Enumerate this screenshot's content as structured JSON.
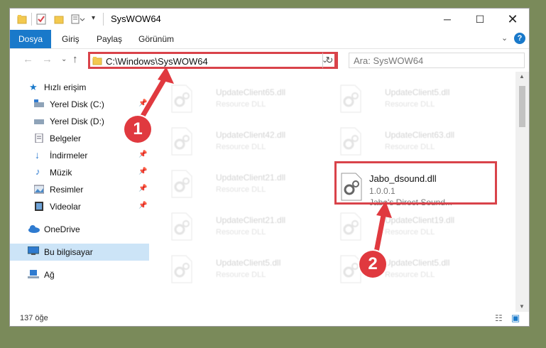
{
  "window": {
    "title": "SysWOW64"
  },
  "ribbon": {
    "tabs": [
      "Dosya",
      "Giriş",
      "Paylaş",
      "Görünüm"
    ]
  },
  "address": {
    "path": "C:\\Windows\\SysWOW64",
    "search_placeholder": "Ara: SysWOW64"
  },
  "sidebar": {
    "items": [
      {
        "label": "Hızlı erişim"
      },
      {
        "label": "Yerel Disk (C:)"
      },
      {
        "label": "Yerel Disk (D:)"
      },
      {
        "label": "Belgeler"
      },
      {
        "label": "İndirmeler"
      },
      {
        "label": "Müzik"
      },
      {
        "label": "Resimler"
      },
      {
        "label": "Videolar"
      },
      {
        "label": "OneDrive"
      },
      {
        "label": "Bu bilgisayar"
      },
      {
        "label": "Ağ"
      }
    ]
  },
  "files": [
    {
      "name": "UpdateClient65.dll",
      "desc": "Resource DLL"
    },
    {
      "name": "UpdateClient5.dll",
      "desc": "Resource DLL"
    },
    {
      "name": "UpdateClient42.dll",
      "desc": "Resource DLL"
    },
    {
      "name": "UpdateClient63.dll",
      "desc": "Resource DLL"
    },
    {
      "name": "UpdateClient21.dll",
      "desc": "Resource DLL"
    },
    {
      "name": "Jabo_dsound.dll",
      "version": "1.0.0.1",
      "desc": "Jabo's Direct Sound..."
    },
    {
      "name": "UpdateClient21.dll",
      "desc": "Resource DLL"
    },
    {
      "name": "UpdateClient19.dll",
      "desc": "Resource DLL"
    },
    {
      "name": "UpdateClient5.dll",
      "desc": "Resource DLL"
    },
    {
      "name": "UpdateClient5.dll",
      "desc": "Resource DLL"
    }
  ],
  "status": {
    "count": "137 öğe"
  },
  "annotations": {
    "step1": "1",
    "step2": "2"
  },
  "colors": {
    "accent": "#1979ca",
    "highlight": "#d9434a",
    "selected": "#cce4f7"
  }
}
